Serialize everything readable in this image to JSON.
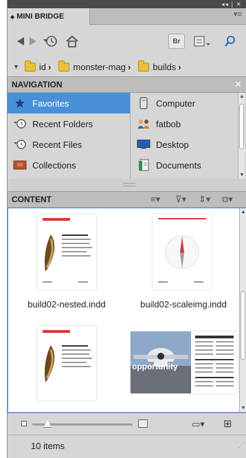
{
  "panel": {
    "title": "MINI BRIDGE",
    "top_controls": "◂◂ | ✕",
    "menu_glyph": "▾≡"
  },
  "toolbar": {
    "bridge_button": "Br"
  },
  "breadcrumb": [
    {
      "label": "id"
    },
    {
      "label": "monster-mag"
    },
    {
      "label": "builds"
    }
  ],
  "navigation": {
    "title": "NAVIGATION",
    "close_glyph": "✕",
    "left_items": [
      {
        "label": "Favorites",
        "icon": "star-icon",
        "selected": true
      },
      {
        "label": "Recent Folders",
        "icon": "recent-folders-icon",
        "selected": false
      },
      {
        "label": "Recent Files",
        "icon": "recent-files-icon",
        "selected": false
      },
      {
        "label": "Collections",
        "icon": "collections-icon",
        "selected": false
      }
    ],
    "right_items": [
      {
        "label": "Computer",
        "icon": "computer-icon"
      },
      {
        "label": "fatbob",
        "icon": "user-icon"
      },
      {
        "label": "Desktop",
        "icon": "desktop-icon"
      },
      {
        "label": "Documents",
        "icon": "documents-icon"
      }
    ]
  },
  "content": {
    "title": "CONTENT",
    "items": [
      {
        "name": "build02-nested.indd",
        "thumbnail": "banana-page"
      },
      {
        "name": "build02-scaleimg.indd",
        "thumbnail": "compass-page"
      },
      {
        "name": "",
        "thumbnail": "banana-page"
      },
      {
        "name": "",
        "thumbnail": "airplane-spread",
        "overlay_text": "opportunity"
      }
    ]
  },
  "status": {
    "count_text": "10 items"
  },
  "colors": {
    "selection": "#4a90d9",
    "panel_bg": "#d6d6d6",
    "header_bg": "#bdbdbd",
    "content_border": "#5aa0e0"
  }
}
